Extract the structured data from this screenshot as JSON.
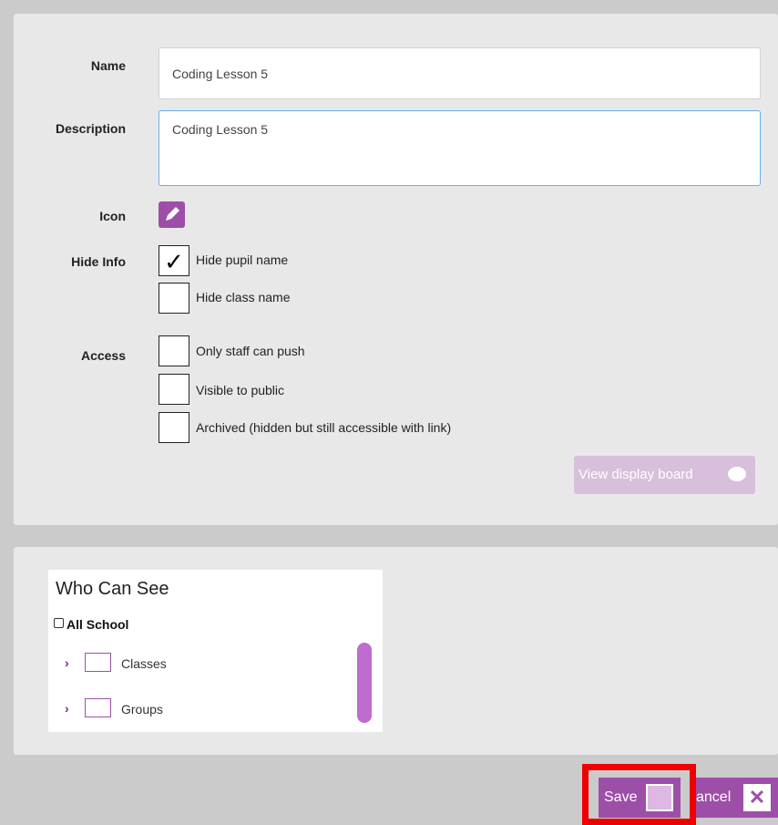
{
  "form": {
    "name_label": "Name",
    "name_value": "Coding Lesson 5",
    "description_label": "Description",
    "description_value": "Coding Lesson 5",
    "icon_label": "Icon",
    "hide_info_label": "Hide Info",
    "hide_pupil_label": "Hide pupil name",
    "hide_class_label": "Hide class name",
    "access_label": "Access",
    "only_staff_label": "Only staff can push",
    "visible_public_label": "Visible to public",
    "archived_label": "Archived (hidden but still accessible with link)",
    "view_display_board_label": "View display board",
    "hide_pupil_checked": true,
    "checkmark": "✓"
  },
  "who_can_see": {
    "title": "Who Can See",
    "all_school_label": "All School",
    "classes_label": "Classes",
    "groups_label": "Groups"
  },
  "footer": {
    "save_label": "Save",
    "cancel_label": "ancel",
    "close_glyph": "✕"
  },
  "colors": {
    "accent": "#9d4fa8",
    "highlight": "#ef0000"
  }
}
